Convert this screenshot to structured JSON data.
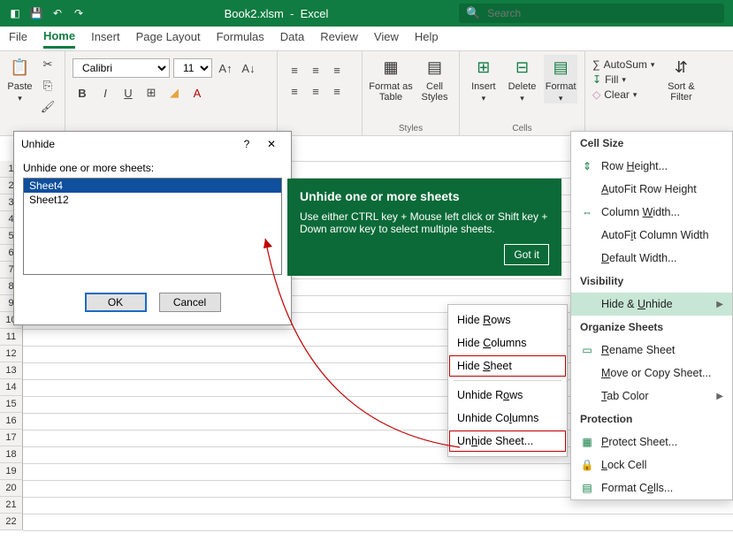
{
  "titlebar": {
    "doc": "Book2.xlsm",
    "app": "Excel",
    "search_placeholder": "Search"
  },
  "tabs": [
    "File",
    "Home",
    "Insert",
    "Page Layout",
    "Formulas",
    "Data",
    "Review",
    "View",
    "Help"
  ],
  "active_tab": "Home",
  "ribbon": {
    "clipboard": {
      "paste": "Paste",
      "label": ""
    },
    "font": {
      "name": "Calibri",
      "size": "11",
      "bold": "B",
      "italic": "I",
      "underline": "U"
    },
    "styles": {
      "format_as_table": "Format as\nTable",
      "cell_styles": "Cell\nStyles",
      "label": "Styles"
    },
    "cells": {
      "insert": "Insert",
      "delete": "Delete",
      "format": "Format",
      "label": "Cells"
    },
    "editing": {
      "autosum": "AutoSum",
      "fill": "Fill",
      "clear": "Clear",
      "sortfilter": "Sort &\nFilter"
    }
  },
  "dialog": {
    "title": "Unhide",
    "label": "Unhide one or more sheets:",
    "items": [
      "Sheet4",
      "Sheet12"
    ],
    "selected": 0,
    "ok": "OK",
    "cancel": "Cancel"
  },
  "tooltip": {
    "heading": "Unhide one or more sheets",
    "body": "Use either CTRL key + Mouse left click or Shift key + Down arrow key to select multiple sheets.",
    "gotit": "Got it"
  },
  "dropdown": {
    "cell_size": "Cell Size",
    "row_height": "Row Height...",
    "autofit_row": "AutoFit Row Height",
    "col_width": "Column Width...",
    "autofit_col": "AutoFit Column Width",
    "default_width": "Default Width...",
    "visibility": "Visibility",
    "hide_unhide": "Hide & Unhide",
    "organize": "Organize Sheets",
    "rename": "Rename Sheet",
    "move_copy": "Move or Copy Sheet...",
    "tab_color": "Tab Color",
    "protection": "Protection",
    "protect_sheet": "Protect Sheet...",
    "lock_cell": "Lock Cell",
    "format_cells": "Format Cells..."
  },
  "submenu": {
    "hide_rows": "Hide Rows",
    "hide_cols": "Hide Columns",
    "hide_sheet": "Hide Sheet",
    "unhide_rows": "Unhide Rows",
    "unhide_cols": "Unhide Columns",
    "unhide_sheet": "Unhide Sheet..."
  },
  "rows": [
    "1",
    "2",
    "3",
    "4",
    "5",
    "6",
    "7",
    "8",
    "9",
    "10",
    "11",
    "12",
    "13",
    "14",
    "15",
    "16",
    "17",
    "18",
    "19",
    "20",
    "21",
    "22"
  ]
}
